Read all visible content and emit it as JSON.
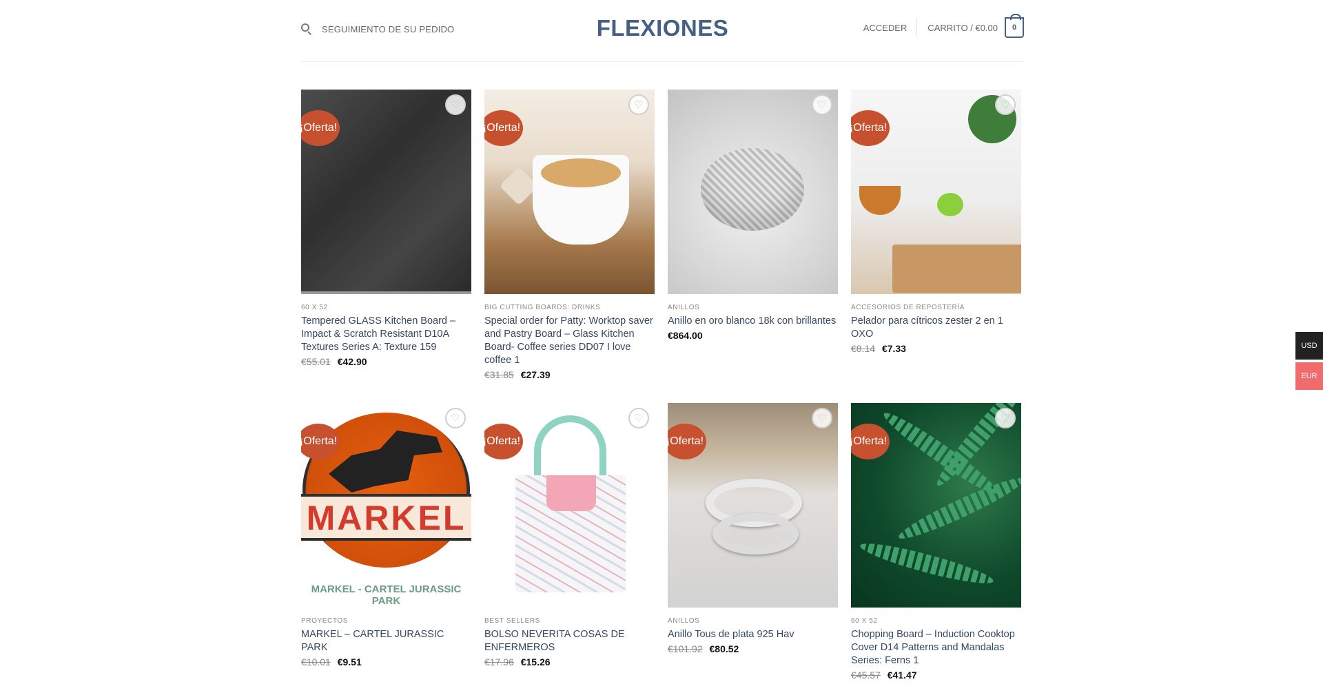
{
  "header": {
    "track_order": "SEGUIMIENTO DE SU PEDIDO",
    "logo": "FLEXIONES",
    "login": "ACCEDER",
    "cart": "CARRITO / €0.00",
    "cart_count": "0"
  },
  "colors": {
    "brand": "#446084",
    "sale_badge": "#c7502f",
    "currency_active": "#222222",
    "currency_eur": "#f06b6b"
  },
  "icons": {
    "search": "search-icon",
    "wishlist": "heart-icon",
    "cart": "cart-bag-icon"
  },
  "products": [
    {
      "badge": "¡Oferta!",
      "category": "60 X 52",
      "name": "Tempered GLASS Kitchen Board – Impact & Scratch Resistant D10A Textures Series A: Texture 159",
      "old_price": "€55.01",
      "price": "€42.90"
    },
    {
      "badge": "¡Oferta!",
      "category": "BIG CUTTING BOARDS: DRINKS",
      "name": "Special order for Patty: Worktop saver and Pastry Board – Glass Kitchen Board- Coffee series DD07 I love coffee 1",
      "old_price": "€31.85",
      "price": "€27.39"
    },
    {
      "badge": "",
      "category": "ANILLOS",
      "name": "Anillo en oro blanco 18k con brillantes",
      "old_price": "",
      "price": "€864.00"
    },
    {
      "badge": "¡Oferta!",
      "category": "ACCESORIOS DE REPOSTERÍA",
      "name": "Pelador para cítricos zester 2 en 1 OXO",
      "old_price": "€8.14",
      "price": "€7.33"
    },
    {
      "badge": "¡Oferta!",
      "category": "PROYECTOS",
      "name": "MARKEL – CARTEL JURASSIC PARK",
      "old_price": "€10.01",
      "price": "€9.51",
      "image_text": "MARKEL",
      "image_caption": "MARKEL - CARTEL JURASSIC PARK"
    },
    {
      "badge": "¡Oferta!",
      "category": "BEST SELLERS",
      "name": "BOLSO NEVERITA COSAS DE ENFERMEROS",
      "old_price": "€17.96",
      "price": "€15.26"
    },
    {
      "badge": "¡Oferta!",
      "category": "ANILLOS",
      "name": "Anillo Tous de plata 925 Hav",
      "old_price": "€101.92",
      "price": "€80.52"
    },
    {
      "badge": "¡Oferta!",
      "category": "60 X 52",
      "name": "Chopping Board – Induction Cooktop Cover D14 Patterns and Mandalas Series: Ferns 1",
      "old_price": "€45.57",
      "price": "€41.47"
    }
  ],
  "currency": {
    "usd": "USD",
    "eur": "EUR"
  }
}
